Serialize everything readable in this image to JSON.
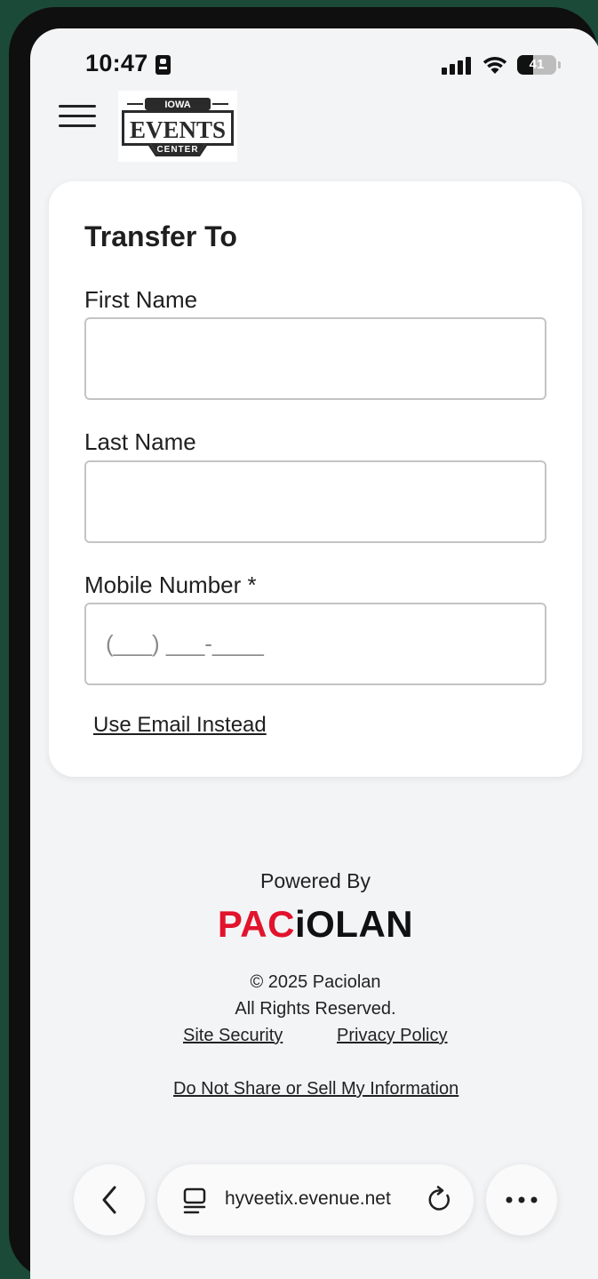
{
  "status_bar": {
    "time": "10:47",
    "battery": "41",
    "battery_level": 0.41
  },
  "header": {
    "menu_icon": "hamburger-menu-icon",
    "logo_alt": "Iowa Events Center",
    "logo_top": "IOWA",
    "logo_main": "EVENTS",
    "logo_bottom": "CENTER"
  },
  "form": {
    "title": "Transfer To",
    "first_name": {
      "label": "First Name",
      "value": "",
      "placeholder": ""
    },
    "last_name": {
      "label": "Last Name",
      "value": "",
      "placeholder": ""
    },
    "mobile": {
      "label": "Mobile Number *",
      "value": "",
      "placeholder": "(___) ___-____"
    },
    "email_link": "Use Email Instead"
  },
  "footer": {
    "powered_by": "Powered By",
    "brand_red": "PAC",
    "brand_dark": "iOLAN",
    "copyright": "© 2025 Paciolan",
    "rights": "All Rights Reserved.",
    "links": {
      "site_security": "Site Security",
      "privacy_policy": "Privacy Policy",
      "do_not_share": "Do Not Share or Sell My Information"
    }
  },
  "browser": {
    "url": "hyveetix.evenue.net",
    "back_icon": "chevron-left-icon",
    "tabs_icon": "tab-icon",
    "reload_icon": "reload-icon",
    "more_icon": "more-icon"
  },
  "colors": {
    "frame": "#1c4a38",
    "brand_red": "#e2132d",
    "card_bg": "#ffffff",
    "screen_bg": "#f3f4f6"
  }
}
